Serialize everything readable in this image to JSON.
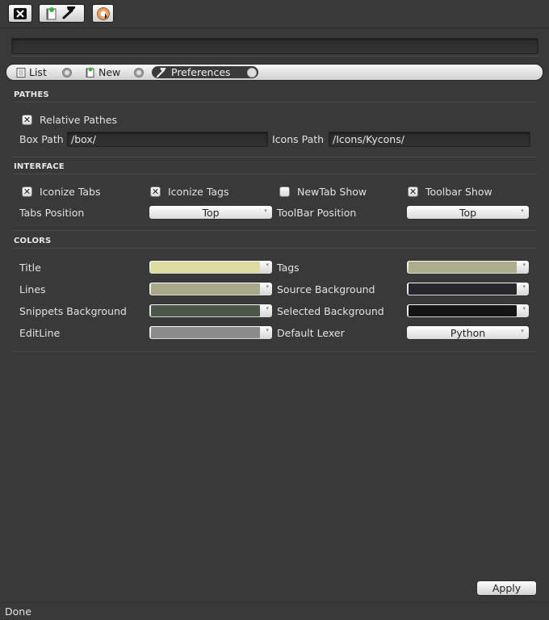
{
  "toolbar": {
    "buttons": [
      {
        "name": "close-icon"
      },
      {
        "name": "new-note-icon"
      },
      {
        "name": "preferences-icon"
      }
    ],
    "address_value": ""
  },
  "tabs": [
    {
      "label": "List",
      "active": false
    },
    {
      "label": "New",
      "active": false
    },
    {
      "label": "Preferences",
      "active": true
    }
  ],
  "pathes": {
    "title": "PATHES",
    "relative_label": "Relative Pathes",
    "relative_checked": true,
    "box_path_label": "Box Path",
    "box_path_value": "/box/",
    "icons_path_label": "Icons Path",
    "icons_path_value": "/Icons/Kycons/"
  },
  "interface": {
    "title": "INTERFACE",
    "checks": [
      {
        "label": "Iconize Tabs",
        "checked": true
      },
      {
        "label": "Iconize Tags",
        "checked": true
      },
      {
        "label": "NewTab Show",
        "checked": false
      },
      {
        "label": "Toolbar Show",
        "checked": true
      }
    ],
    "tabs_position_label": "Tabs Position",
    "tabs_position_value": "Top",
    "toolbar_position_label": "ToolBar Position",
    "toolbar_position_value": "Top"
  },
  "colors": {
    "title": "COLORS",
    "title_label": "Title",
    "title_color": "#dcdba0",
    "tags_label": "Tags",
    "tags_color": "#aeae8e",
    "lines_label": "Lines",
    "lines_color": "#a9a98a",
    "source_bg_label": "Source Background",
    "source_bg_color": "#27262d",
    "snippets_bg_label": "Snippets Background",
    "snippets_bg_color": "#4b5548",
    "selected_bg_label": "Selected Background",
    "selected_bg_color": "#141414",
    "editline_label": "EditLine",
    "editline_color": "#8b8b8b",
    "default_lexer_label": "Default Lexer",
    "default_lexer_value": "Python"
  },
  "apply_label": "Apply",
  "status_text": "Done",
  "check_glyph": "✕"
}
